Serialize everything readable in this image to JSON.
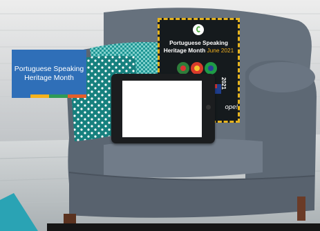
{
  "sign_blue": {
    "line1": "Portuguese Speaking",
    "line2": "Heritage Month",
    "stripe_colors": [
      "#2f6fb8",
      "#f5b21b",
      "#2f9b57",
      "#e35f2a"
    ]
  },
  "poster": {
    "title_line1": "Portuguese Speaking",
    "title_line2": "Heritage Month",
    "date": "June 2021",
    "year": "2021",
    "tagline": "ope!"
  },
  "tablet": {
    "screen_color": "#ffffff"
  },
  "colors": {
    "chair": "#5f6b78",
    "pillow_teal": "#1d8c8a",
    "pillow_check": "#38a3a1"
  }
}
